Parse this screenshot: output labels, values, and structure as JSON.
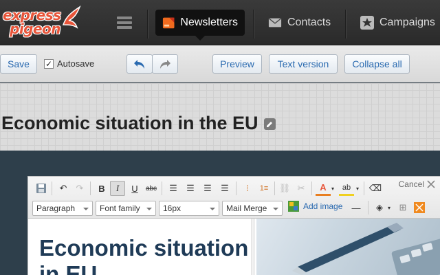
{
  "brand": {
    "line1": "express",
    "line2": "pigeon"
  },
  "nav": {
    "items": [
      {
        "label": "Newsletters",
        "active": true
      },
      {
        "label": "Contacts",
        "active": false
      },
      {
        "label": "Campaigns",
        "active": false
      }
    ]
  },
  "actions": {
    "save": "Save",
    "autosave": "Autosave",
    "autosave_checked": true,
    "preview": "Preview",
    "text_version": "Text version",
    "collapse_all": "Collapse all"
  },
  "page": {
    "title": "Economic situation in the EU"
  },
  "editor": {
    "cancel": "Cancel",
    "format": "Paragraph",
    "font_family": "Font family",
    "font_size": "16px",
    "mail_merge": "Mail Merge",
    "add_image": "Add image",
    "headline": "Economic situation in EU"
  },
  "colors": {
    "accent": "#2a6ab0",
    "brand": "#e8553a",
    "headline": "#1f3b57"
  }
}
